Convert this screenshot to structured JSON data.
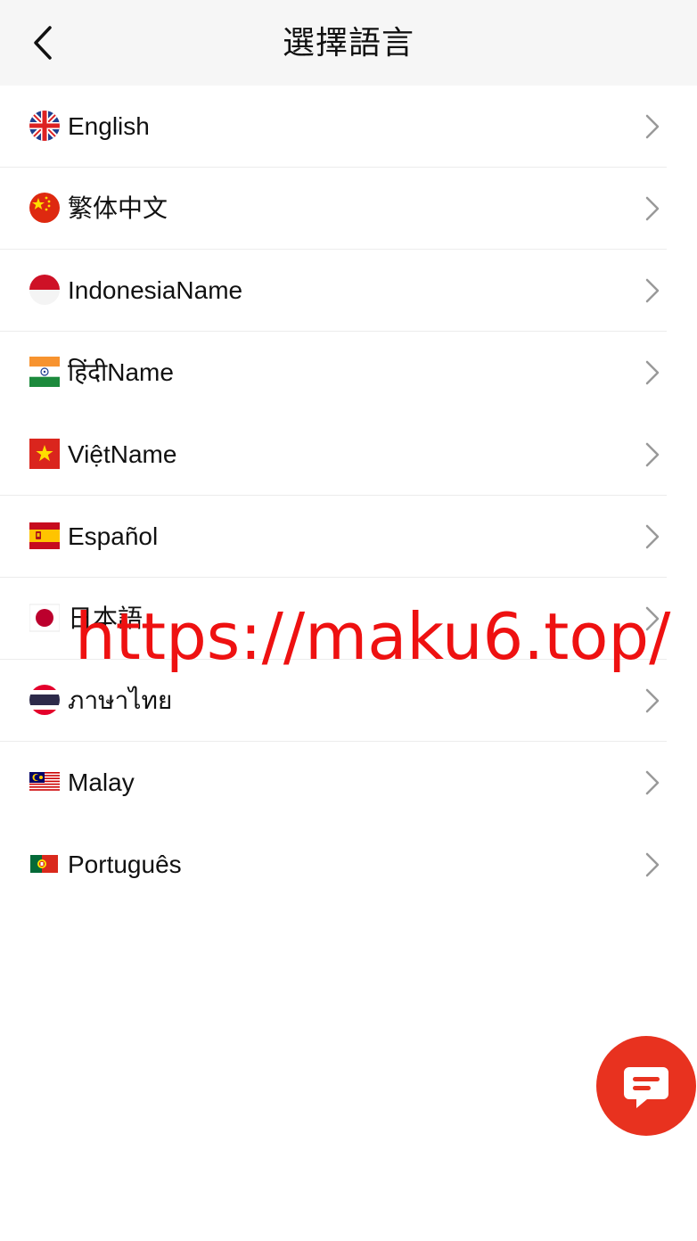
{
  "header": {
    "title": "選擇語言"
  },
  "languages": [
    {
      "label": "English",
      "flag": "uk-flag-icon"
    },
    {
      "label": "繁体中文",
      "flag": "china-flag-icon"
    },
    {
      "label": "IndonesiaName",
      "flag": "indonesia-flag-icon"
    },
    {
      "label": "हिंदीName",
      "flag": "india-flag-icon"
    },
    {
      "label": "ViệtName",
      "flag": "vietnam-flag-icon"
    },
    {
      "label": "Español",
      "flag": "spain-flag-icon"
    },
    {
      "label": "日本語",
      "flag": "japan-flag-icon"
    },
    {
      "label": "ภาษาไทย",
      "flag": "thailand-flag-icon"
    },
    {
      "label": "Malay",
      "flag": "malaysia-flag-icon"
    },
    {
      "label": "Português",
      "flag": "portugal-flag-icon"
    }
  ],
  "watermark": "https://maku6.top/",
  "colors": {
    "accent": "#e8321f",
    "header_bg": "#f6f6f6",
    "watermark": "#ee1111"
  }
}
